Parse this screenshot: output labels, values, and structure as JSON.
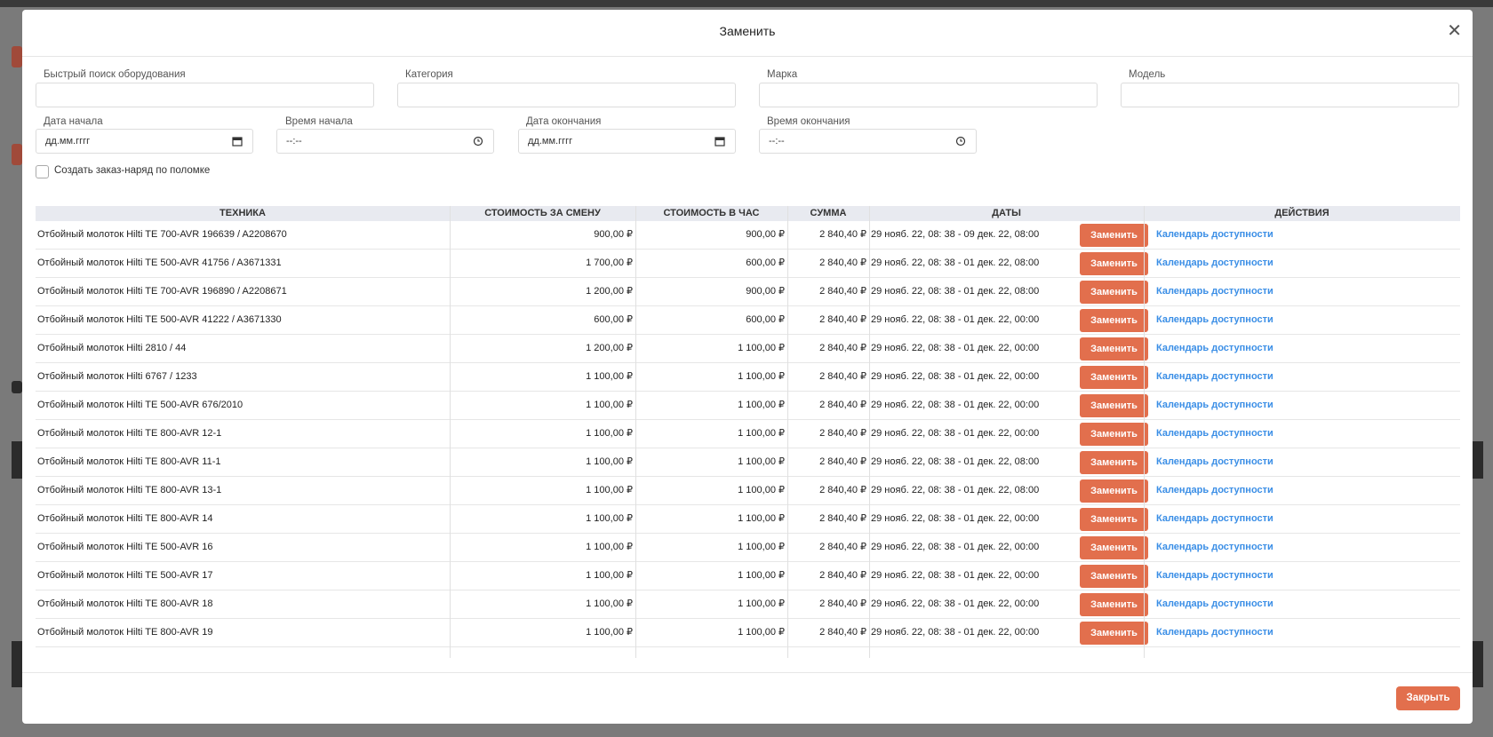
{
  "modal": {
    "title": "Заменить",
    "close_icon": "close-icon"
  },
  "filters": {
    "quick_search": {
      "label": "Быстрый поиск оборудования",
      "value": ""
    },
    "category": {
      "label": "Категория",
      "value": ""
    },
    "brand": {
      "label": "Марка",
      "value": ""
    },
    "model": {
      "label": "Модель",
      "value": ""
    },
    "start_date": {
      "label": "Дата начала",
      "placeholder": "дд.мм.гггг"
    },
    "start_time": {
      "label": "Время начала",
      "placeholder": "--:--"
    },
    "end_date": {
      "label": "Дата окончания",
      "placeholder": "дд.мм.гггг"
    },
    "end_time": {
      "label": "Время окончания",
      "placeholder": "--:--"
    },
    "create_order_checkbox": {
      "label": "Создать заказ-наряд по поломке",
      "checked": false
    }
  },
  "table": {
    "columns": [
      "ТЕХНИКА",
      "СТОИМОСТЬ ЗА СМЕНУ",
      "СТОИМОСТЬ В ЧАС",
      "СУММА",
      "ДАТЫ",
      "ДЕЙСТВИЯ"
    ],
    "action_label": "Заменить",
    "calendar_label": "Календарь доступности",
    "rows": [
      [
        "Отбойный молоток Hilti TE 700-AVR 196639 / A2208670",
        "900,00 ₽",
        "900,00 ₽",
        "2 840,40 ₽",
        "29 нояб. 22, 08: 38 - 09 дек. 22, 08:00"
      ],
      [
        "Отбойный молоток Hilti TE 500-AVR 41756 / A3671331",
        "1 700,00 ₽",
        "600,00 ₽",
        "2 840,40 ₽",
        "29 нояб. 22, 08: 38 - 01 дек. 22, 08:00"
      ],
      [
        "Отбойный молоток Hilti TE 700-AVR 196890 / A2208671",
        "1 200,00 ₽",
        "900,00 ₽",
        "2 840,40 ₽",
        "29 нояб. 22, 08: 38 - 01 дек. 22, 08:00"
      ],
      [
        "Отбойный молоток Hilti TE 500-AVR 41222 / A3671330",
        "600,00 ₽",
        "600,00 ₽",
        "2 840,40 ₽",
        "29 нояб. 22, 08: 38 - 01 дек. 22, 00:00"
      ],
      [
        "Отбойный молоток Hilti 2810 / 44",
        "1 200,00 ₽",
        "1 100,00 ₽",
        "2 840,40 ₽",
        "29 нояб. 22, 08: 38 - 01 дек. 22, 00:00"
      ],
      [
        "Отбойный молоток Hilti 6767 / 1233",
        "1 100,00 ₽",
        "1 100,00 ₽",
        "2 840,40 ₽",
        "29 нояб. 22, 08: 38 - 01 дек. 22, 00:00"
      ],
      [
        "Отбойный молоток Hilti TE 500-AVR 676/2010",
        "1 100,00 ₽",
        "1 100,00 ₽",
        "2 840,40 ₽",
        "29 нояб. 22, 08: 38 - 01 дек. 22, 00:00"
      ],
      [
        "Отбойный молоток Hilti TE 800-AVR 12-1",
        "1 100,00 ₽",
        "1 100,00 ₽",
        "2 840,40 ₽",
        "29 нояб. 22, 08: 38 - 01 дек. 22, 00:00"
      ],
      [
        "Отбойный молоток Hilti TE 800-AVR 11-1",
        "1 100,00 ₽",
        "1 100,00 ₽",
        "2 840,40 ₽",
        "29 нояб. 22, 08: 38 - 01 дек. 22, 08:00"
      ],
      [
        "Отбойный молоток Hilti TE 800-AVR 13-1",
        "1 100,00 ₽",
        "1 100,00 ₽",
        "2 840,40 ₽",
        "29 нояб. 22, 08: 38 - 01 дек. 22, 08:00"
      ],
      [
        "Отбойный молоток Hilti TE 800-AVR 14",
        "1 100,00 ₽",
        "1 100,00 ₽",
        "2 840,40 ₽",
        "29 нояб. 22, 08: 38 - 01 дек. 22, 00:00"
      ],
      [
        "Отбойный молоток Hilti TE 500-AVR 16",
        "1 100,00 ₽",
        "1 100,00 ₽",
        "2 840,40 ₽",
        "29 нояб. 22, 08: 38 - 01 дек. 22, 00:00"
      ],
      [
        "Отбойный молоток Hilti TE 500-AVR 17",
        "1 100,00 ₽",
        "1 100,00 ₽",
        "2 840,40 ₽",
        "29 нояб. 22, 08: 38 - 01 дек. 22, 00:00"
      ],
      [
        "Отбойный молоток Hilti TE 800-AVR 18",
        "1 100,00 ₽",
        "1 100,00 ₽",
        "2 840,40 ₽",
        "29 нояб. 22, 08: 38 - 01 дек. 22, 00:00"
      ],
      [
        "Отбойный молоток Hilti TE 800-AVR 19",
        "1 100,00 ₽",
        "1 100,00 ₽",
        "2 840,40 ₽",
        "29 нояб. 22, 08: 38 - 01 дек. 22, 00:00"
      ]
    ]
  },
  "footer": {
    "close_button": "Закрыть"
  },
  "colors": {
    "accent": "#e26f4d",
    "link": "#3a8ee6",
    "header_bg": "#e8eaf0"
  }
}
